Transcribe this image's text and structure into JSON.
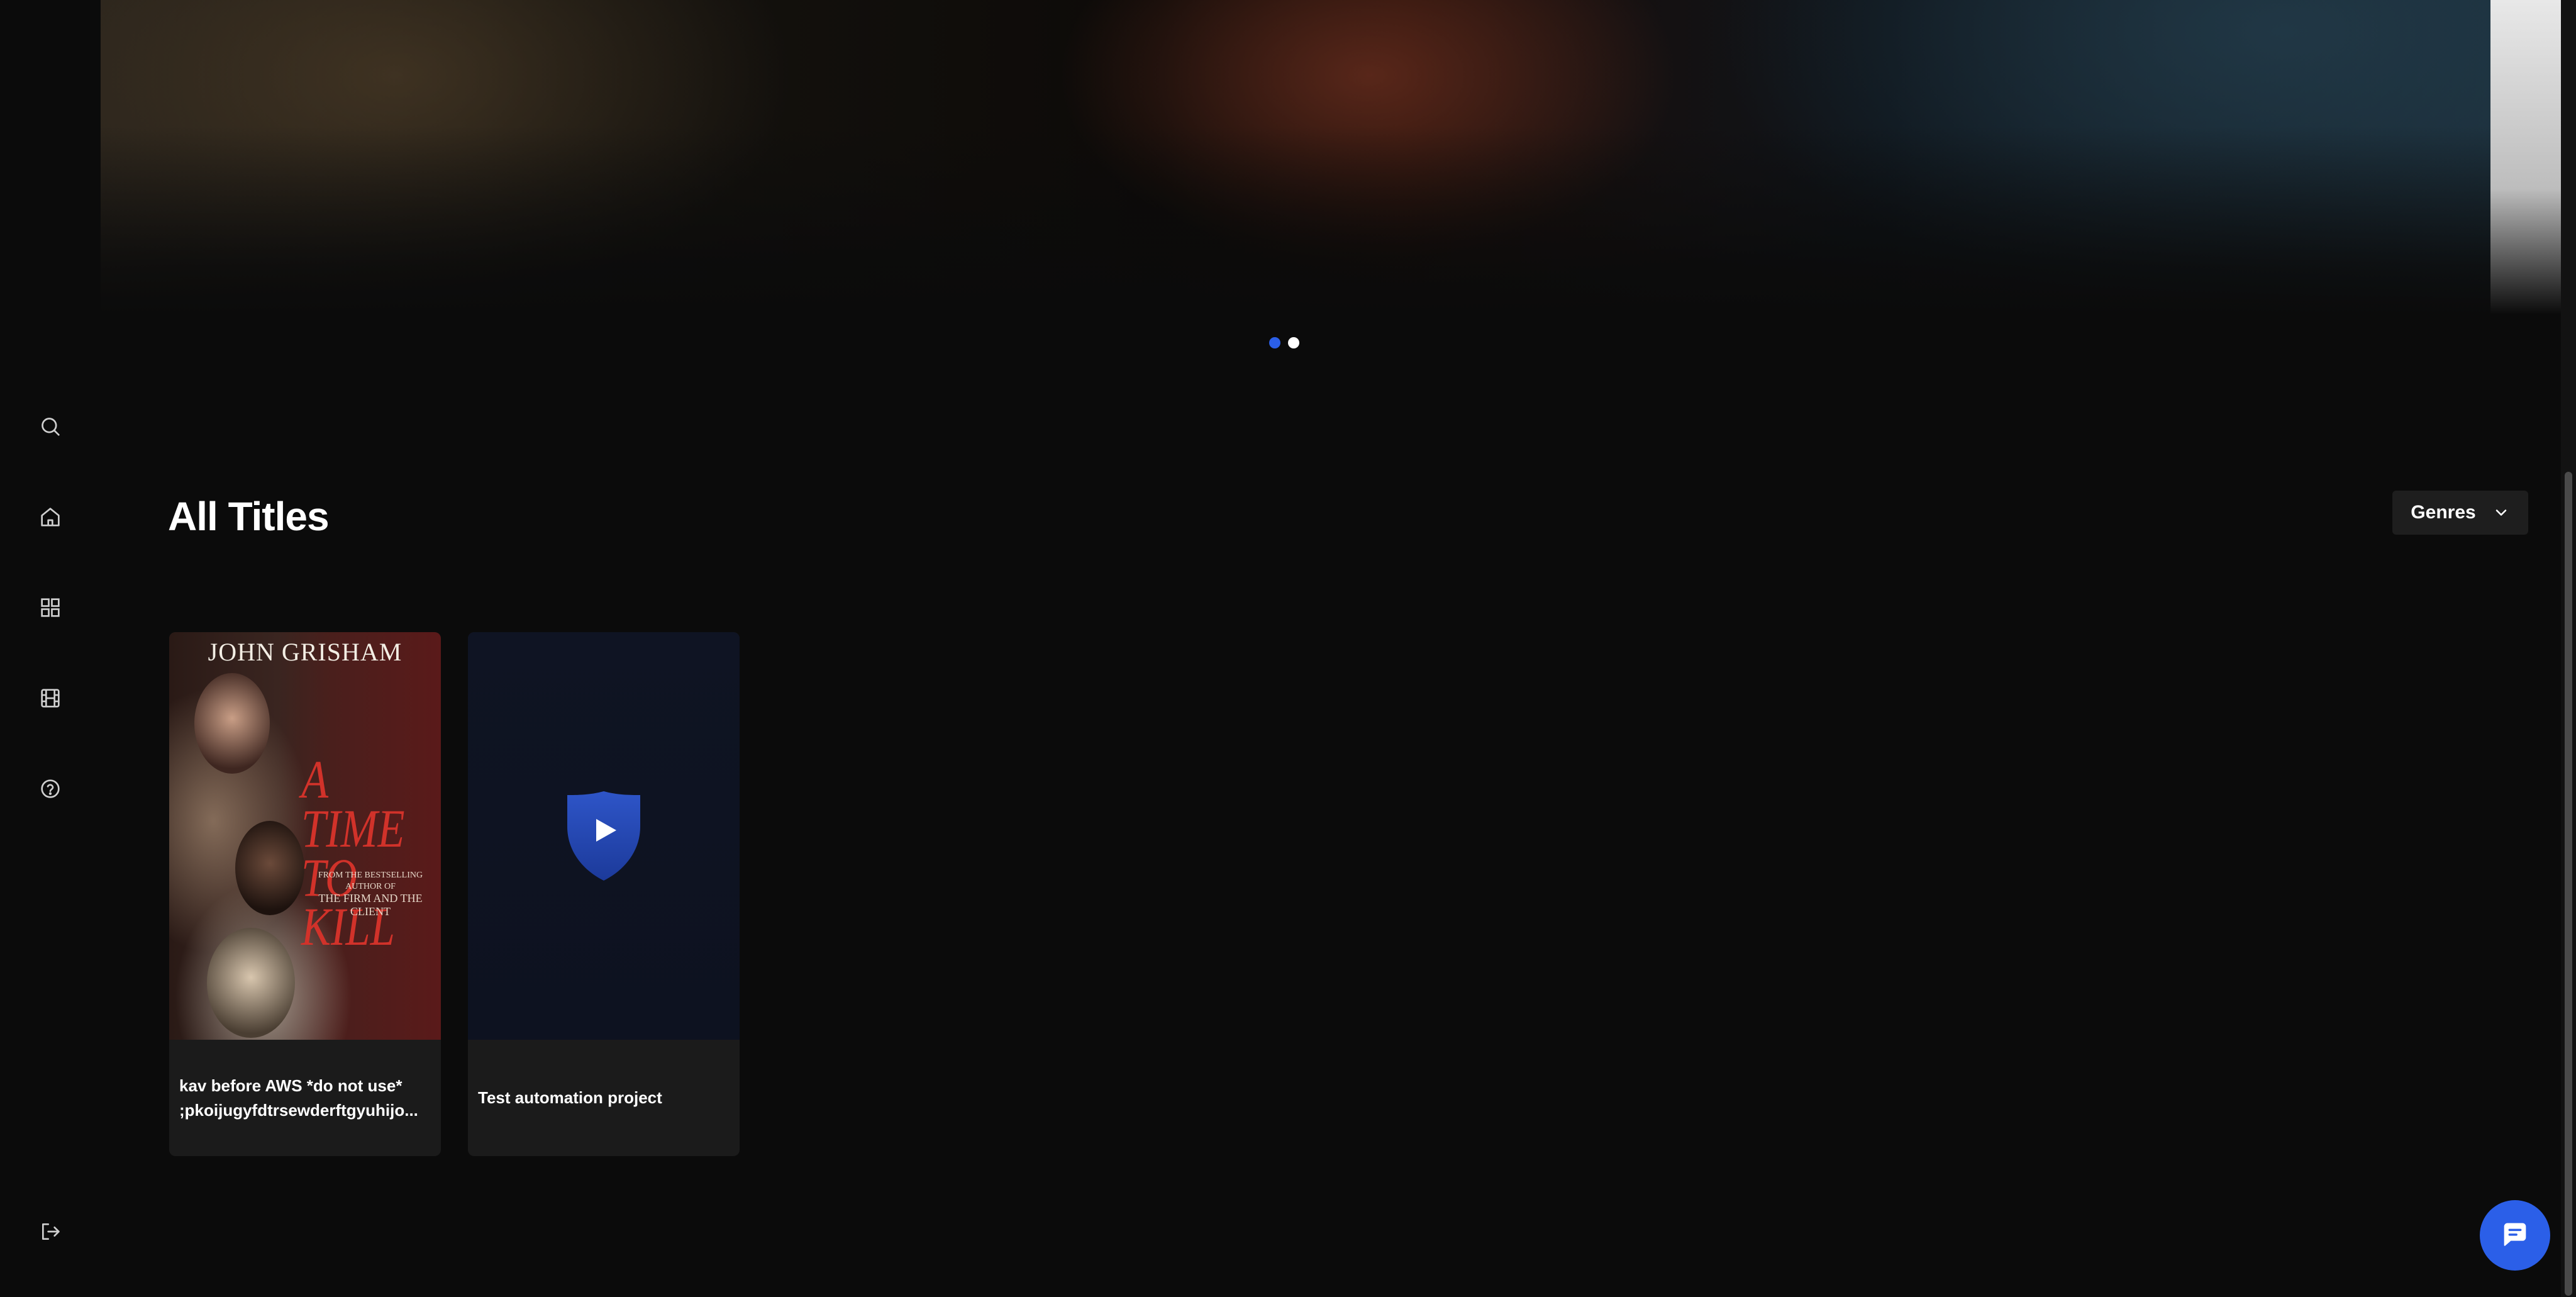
{
  "sidebar": {
    "items": [
      {
        "name": "search",
        "icon": "search-icon"
      },
      {
        "name": "home",
        "icon": "home-icon"
      },
      {
        "name": "categories",
        "icon": "grid-icon"
      },
      {
        "name": "titles",
        "icon": "film-icon"
      },
      {
        "name": "help",
        "icon": "help-icon"
      }
    ],
    "logout_icon": "logout-icon"
  },
  "hero": {
    "slide_count": 2,
    "active_slide": 1
  },
  "main": {
    "title": "All Titles",
    "genres_label": "Genres",
    "titles": [
      {
        "caption_line1": "kav before AWS *do not use*",
        "caption_line2": ";pkoijugyfdtrsewderftgyuhijo...",
        "poster": {
          "author": "JOHN GRISHAM",
          "title": "A TIME TO KILL",
          "credit_line1": "FROM THE BESTSELLING AUTHOR OF",
          "credit_line2": "THE FIRM AND THE CLIENT"
        }
      },
      {
        "caption_line1": "Test automation project",
        "thumbnail_icon": "play-shield-icon"
      }
    ]
  },
  "chat": {
    "icon": "chat-icon",
    "accent": "#2b5fe8"
  }
}
